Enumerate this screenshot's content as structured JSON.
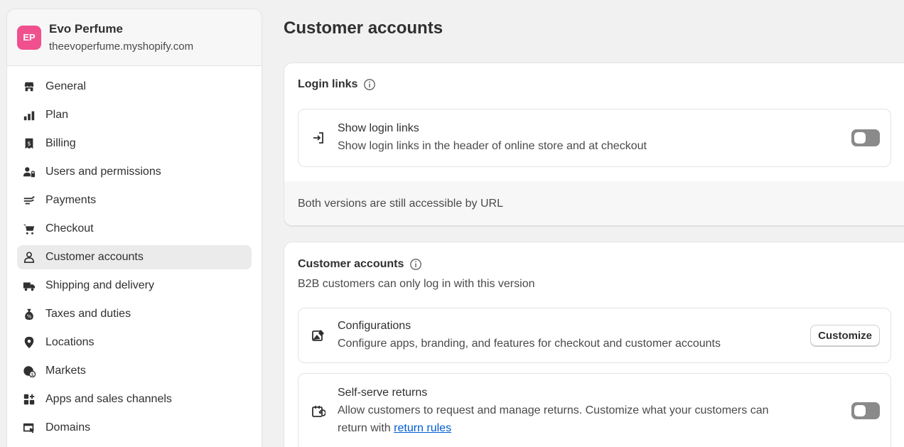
{
  "store": {
    "initials": "EP",
    "name": "Evo Perfume",
    "domain": "theevoperfume.myshopify.com",
    "avatar_color": "#f0508e"
  },
  "sidebar": {
    "items": [
      {
        "label": "General",
        "icon": "store-icon"
      },
      {
        "label": "Plan",
        "icon": "plan-icon"
      },
      {
        "label": "Billing",
        "icon": "receipt-icon"
      },
      {
        "label": "Users and permissions",
        "icon": "users-lock-icon"
      },
      {
        "label": "Payments",
        "icon": "payments-hand-icon"
      },
      {
        "label": "Checkout",
        "icon": "cart-icon"
      },
      {
        "label": "Customer accounts",
        "icon": "person-icon",
        "active": true
      },
      {
        "label": "Shipping and delivery",
        "icon": "truck-icon"
      },
      {
        "label": "Taxes and duties",
        "icon": "tax-bag-icon"
      },
      {
        "label": "Locations",
        "icon": "location-pin-icon"
      },
      {
        "label": "Markets",
        "icon": "globe-dollar-icon"
      },
      {
        "label": "Apps and sales channels",
        "icon": "apps-icon"
      },
      {
        "label": "Domains",
        "icon": "domains-icon"
      }
    ]
  },
  "main": {
    "title": "Customer accounts",
    "login_links": {
      "heading": "Login links",
      "row_title": "Show login links",
      "row_desc": "Show login links in the header of online store and at checkout",
      "footer": "Both versions are still accessible by URL"
    },
    "customer_accounts": {
      "heading": "Customer accounts",
      "subtitle": "B2B customers can only log in with this version",
      "config_title": "Configurations",
      "config_desc": "Configure apps, branding, and features for checkout and customer accounts",
      "customize_label": "Customize",
      "returns_title": "Self-serve returns",
      "returns_desc": "Allow customers to request and manage returns. Customize what your customers can",
      "returns_desc2": "return with ",
      "returns_link": "return rules"
    }
  }
}
